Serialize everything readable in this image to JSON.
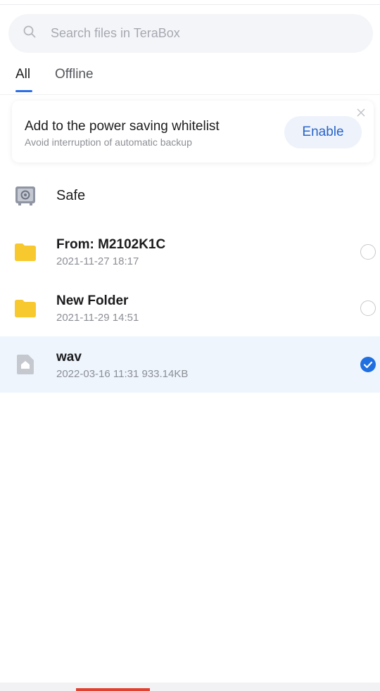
{
  "search": {
    "placeholder": "Search files in TeraBox",
    "icon": "search-icon"
  },
  "tabs": [
    {
      "label": "All",
      "active": true
    },
    {
      "label": "Offline",
      "active": false
    }
  ],
  "banner": {
    "title": "Add to the power saving whitelist",
    "subtitle": "Avoid interruption of automatic backup",
    "button_label": "Enable"
  },
  "safe": {
    "label": "Safe",
    "icon": "safe-icon"
  },
  "files": [
    {
      "name": "From: M2102K1C",
      "meta": "2021-11-27  18:17",
      "icon": "folder-icon",
      "selected": false
    },
    {
      "name": "New Folder",
      "meta": "2021-11-29  14:51",
      "icon": "folder-icon",
      "selected": false
    },
    {
      "name": "wav",
      "meta": "2022-03-16  11:31  933.14KB",
      "icon": "file-icon",
      "selected": true
    }
  ],
  "colors": {
    "accent": "#2a6ee8",
    "folder": "#f7c92f",
    "selected_row": "#eef5fd",
    "bottom_accent": "#e2412f"
  }
}
